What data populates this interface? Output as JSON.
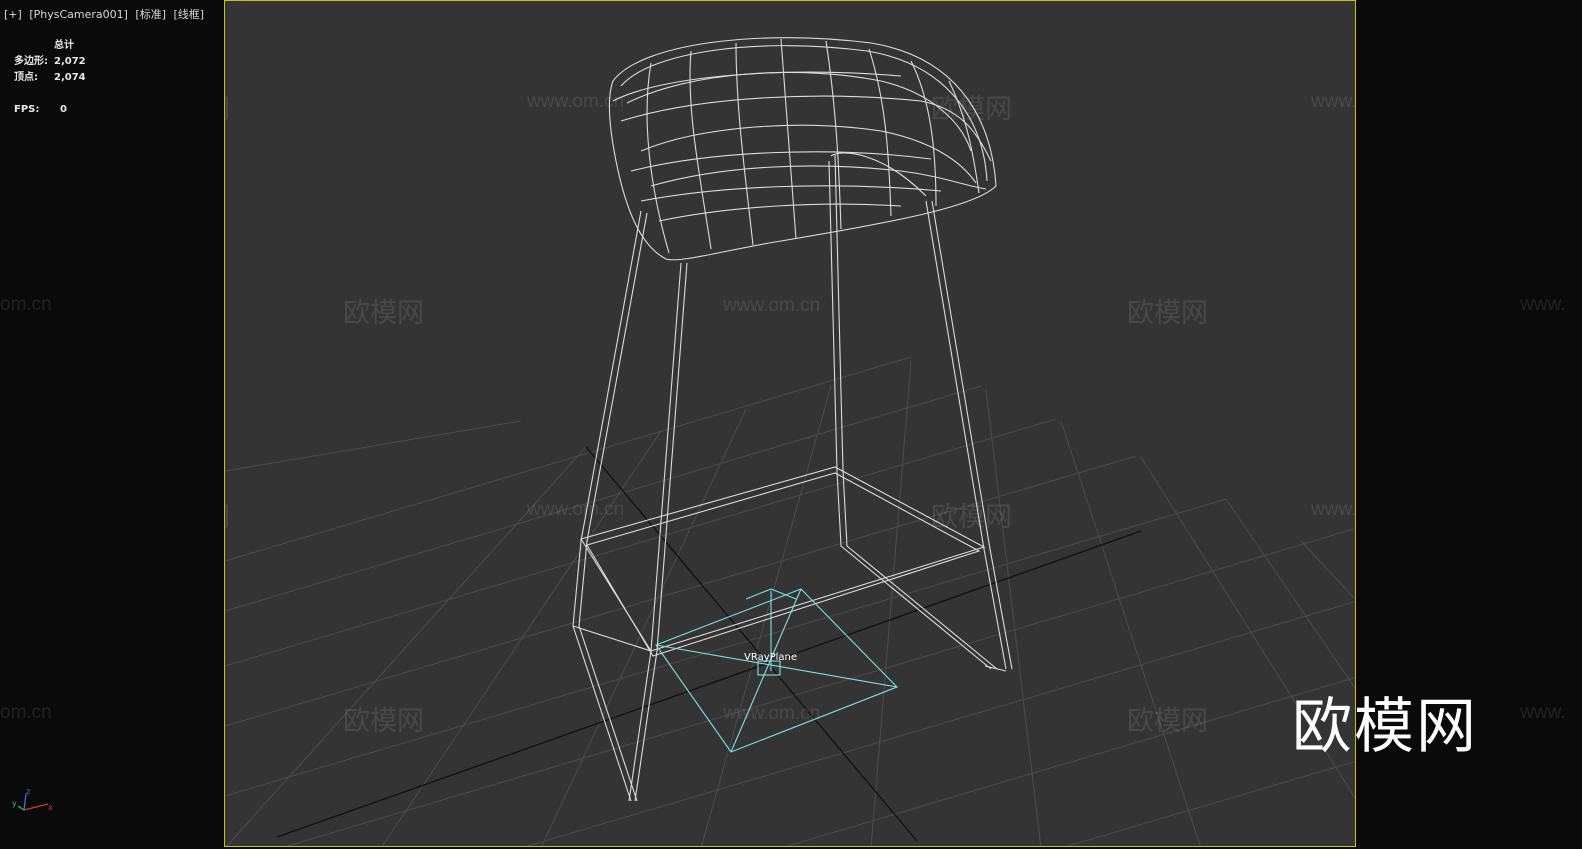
{
  "viewport": {
    "menu": "[+]",
    "camera": "[PhysCamera001]",
    "shading_mode": "[标准]",
    "display_mode": "[线框]"
  },
  "stats": {
    "header": "总计",
    "polygons_label": "多边形:",
    "polygons_value": "2,072",
    "vertices_label": "顶点:",
    "vertices_value": "2,074",
    "fps_label": "FPS:",
    "fps_value": "0"
  },
  "scene": {
    "object_label": "VRayPlane",
    "wireframe_color": "#dcdcdc",
    "helper_color": "#7fe0e0",
    "grid_color": "#4a4a4a",
    "frame_color": "#c9c21a"
  },
  "axis_gizmo": {
    "x": "x",
    "y": "y",
    "z": "z"
  },
  "watermark": {
    "brand": "欧模网",
    "url": "www.om.cn",
    "url_fragment": "om.cn",
    "url_prefix": "www."
  },
  "logo": "欧模网"
}
